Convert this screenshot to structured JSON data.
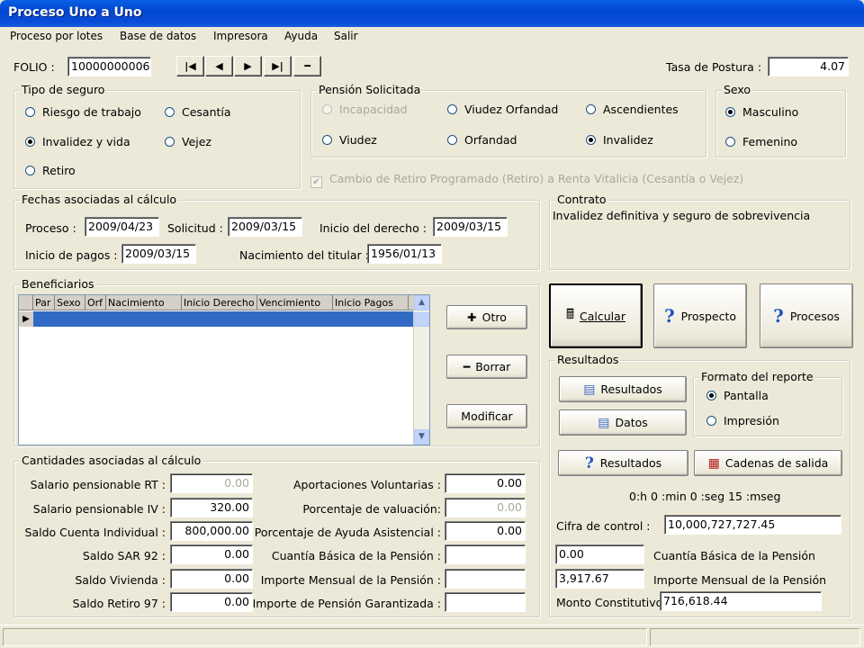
{
  "window": {
    "title": "Proceso Uno a Uno"
  },
  "menu": [
    "Proceso por lotes",
    "Base de datos",
    "Impresora",
    "Ayuda",
    "Salir"
  ],
  "folio": {
    "label": "FOLIO :",
    "value": "10000000006"
  },
  "tasa": {
    "label": "Tasa de Postura :",
    "value": "4.07"
  },
  "tipo_seguro": {
    "title": "Tipo de seguro",
    "options": [
      "Riesgo de trabajo",
      "Cesantía",
      "Invalidez y vida",
      "Vejez",
      "Retiro"
    ],
    "selected": "Invalidez y vida"
  },
  "pension": {
    "title": "Pensión Solicitada",
    "options": [
      "Incapacidad",
      "Viudez Orfandad",
      "Ascendientes",
      "Viudez",
      "Orfandad",
      "Invalidez"
    ],
    "selected": "Invalidez",
    "checkbox": "Cambio de Retiro Programado (Retiro) a Renta Vitalicia (Cesantía o Vejez)"
  },
  "sexo": {
    "title": "Sexo",
    "options": [
      "Masculino",
      "Femenino"
    ],
    "selected": "Masculino"
  },
  "fechas": {
    "title": "Fechas asociadas al cálculo",
    "proceso_label": "Proceso :",
    "proceso": "2009/04/23",
    "solicitud_label": "Solicitud :",
    "solicitud": "2009/03/15",
    "inicio_derecho_label": "Inicio del derecho :",
    "inicio_derecho": "2009/03/15",
    "inicio_pagos_label": "Inicio de pagos :",
    "inicio_pagos": "2009/03/15",
    "nacimiento_label": "Nacimiento del titular :",
    "nacimiento": "1956/01/13"
  },
  "contrato": {
    "title": "Contrato",
    "text": "Invalidez definitiva y seguro de sobrevivencia"
  },
  "beneficiarios": {
    "title": "Beneficiarios",
    "columns": [
      "Par",
      "Sexo",
      "Orf",
      "Nacimiento",
      "Inicio Derecho",
      "Vencimiento",
      "Inicio Pagos"
    ],
    "buttons": {
      "otro": "Otro",
      "borrar": "Borrar",
      "modificar": "Modificar"
    }
  },
  "main_buttons": {
    "calcular": "Calcular",
    "prospecto": "Prospecto",
    "procesos": "Procesos"
  },
  "cantidades": {
    "title": "Cantidades asociadas al cálculo",
    "left": [
      {
        "label": "Salario pensionable RT :",
        "value": "0.00"
      },
      {
        "label": "Salario pensionable IV :",
        "value": "320.00"
      },
      {
        "label": "Saldo Cuenta Individual :",
        "value": "800,000.00"
      },
      {
        "label": "Saldo SAR 92 :",
        "value": "0.00"
      },
      {
        "label": "Saldo Vivienda :",
        "value": "0.00"
      },
      {
        "label": "Saldo Retiro 97 :",
        "value": "0.00"
      }
    ],
    "right": [
      {
        "label": "Aportaciones Voluntarias :",
        "value": "0.00"
      },
      {
        "label": "Porcentaje de valuación:",
        "value": "0.00"
      },
      {
        "label": "Porcentaje de Ayuda Asistencial :",
        "value": "0.00"
      },
      {
        "label": "Cuantía Básica de la Pensión :",
        "value": ""
      },
      {
        "label": "Importe Mensual de la Pensión :",
        "value": ""
      },
      {
        "label": "Importe de Pensión Garantizada :",
        "value": ""
      }
    ]
  },
  "resultados": {
    "title": "Resultados",
    "btn_resultados": "Resultados",
    "btn_datos": "Datos",
    "btn_resultados2": "Resultados",
    "btn_cadenas": "Cadenas de salida",
    "formato": {
      "title": "Formato del reporte",
      "options": [
        "Pantalla",
        "Impresión"
      ],
      "selected": "Pantalla"
    },
    "tiempo": "0:h 0 :min 0 :seg 15 :mseg",
    "cifra_label": "Cifra de control :",
    "cifra": "10,000,727,727.45",
    "cuantia": "0.00",
    "cuantia_label": "Cuantía Básica de la Pensión",
    "importe": "3,917.67",
    "importe_label": "Importe Mensual de la Pensión",
    "monto_label": "Monto Constitutivo",
    "monto": "716,618.44"
  }
}
